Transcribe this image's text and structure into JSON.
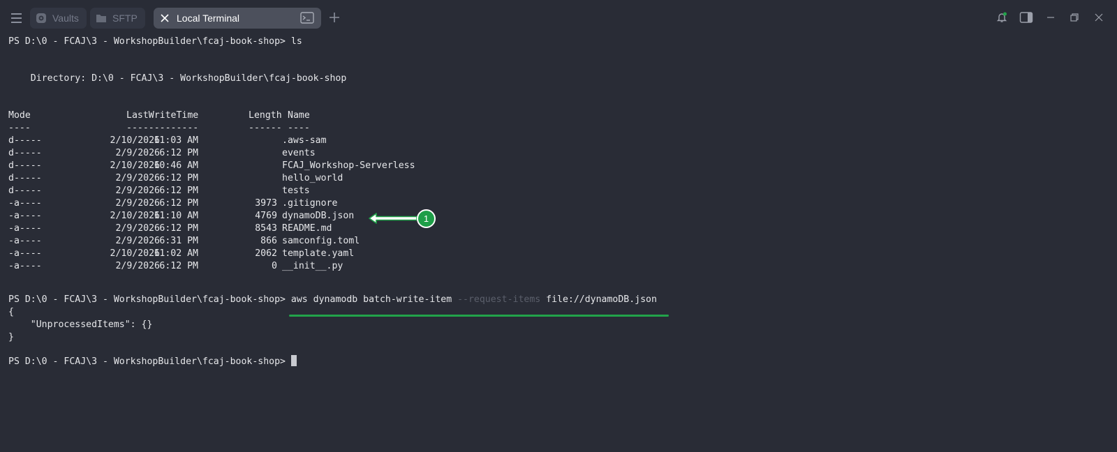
{
  "tabs": {
    "vaults_label": "Vaults",
    "sftp_label": "SFTP",
    "terminal_label": "Local Terminal"
  },
  "terminal": {
    "prompt": "PS D:\\0 - FCAJ\\3 - WorkshopBuilder\\fcaj-book-shop> ",
    "first_command": "ls",
    "directory_line": "    Directory: D:\\0 - FCAJ\\3 - WorkshopBuilder\\fcaj-book-shop",
    "columns": {
      "mode": "Mode",
      "time": "LastWriteTime",
      "length": "Length",
      "name": "Name"
    },
    "separators": {
      "mode": "----",
      "time": "-------------",
      "length": "------",
      "name": "----"
    },
    "rows": [
      {
        "mode": "d-----",
        "date": "2/10/2026",
        "time": "11:03 AM",
        "length": "",
        "name": ".aws-sam"
      },
      {
        "mode": "d-----",
        "date": "2/9/2026",
        "time": "6:12 PM",
        "length": "",
        "name": "events"
      },
      {
        "mode": "d-----",
        "date": "2/10/2026",
        "time": "10:46 AM",
        "length": "",
        "name": "FCAJ_Workshop-Serverless"
      },
      {
        "mode": "d-----",
        "date": "2/9/2026",
        "time": "6:12 PM",
        "length": "",
        "name": "hello_world"
      },
      {
        "mode": "d-----",
        "date": "2/9/2026",
        "time": "6:12 PM",
        "length": "",
        "name": "tests"
      },
      {
        "mode": "-a----",
        "date": "2/9/2026",
        "time": "6:12 PM",
        "length": "3973",
        "name": ".gitignore"
      },
      {
        "mode": "-a----",
        "date": "2/10/2026",
        "time": "11:10 AM",
        "length": "4769",
        "name": "dynamoDB.json"
      },
      {
        "mode": "-a----",
        "date": "2/9/2026",
        "time": "6:12 PM",
        "length": "8543",
        "name": "README.md"
      },
      {
        "mode": "-a----",
        "date": "2/9/2026",
        "time": "6:31 PM",
        "length": "866",
        "name": "samconfig.toml"
      },
      {
        "mode": "-a----",
        "date": "2/10/2026",
        "time": "11:02 AM",
        "length": "2062",
        "name": "template.yaml"
      },
      {
        "mode": "-a----",
        "date": "2/9/2026",
        "time": "6:12 PM",
        "length": "0",
        "name": "__init__.py"
      }
    ],
    "second_command_main": "aws dynamodb batch-write-item ",
    "second_command_flag": "--request-items",
    "second_command_file": " file://dynamoDB.json",
    "output_lines": [
      "{",
      "    \"UnprocessedItems\": {}",
      "}"
    ]
  },
  "annotation": {
    "badge_number": "1",
    "accent_color": "#22a34a"
  },
  "icons": [
    "menu-icon",
    "vault-icon",
    "folder-icon",
    "close-icon",
    "terminal-icon",
    "plus-icon",
    "bell-icon",
    "sidebar-toggle-icon",
    "minimize-icon",
    "restore-icon",
    "window-close-icon"
  ]
}
